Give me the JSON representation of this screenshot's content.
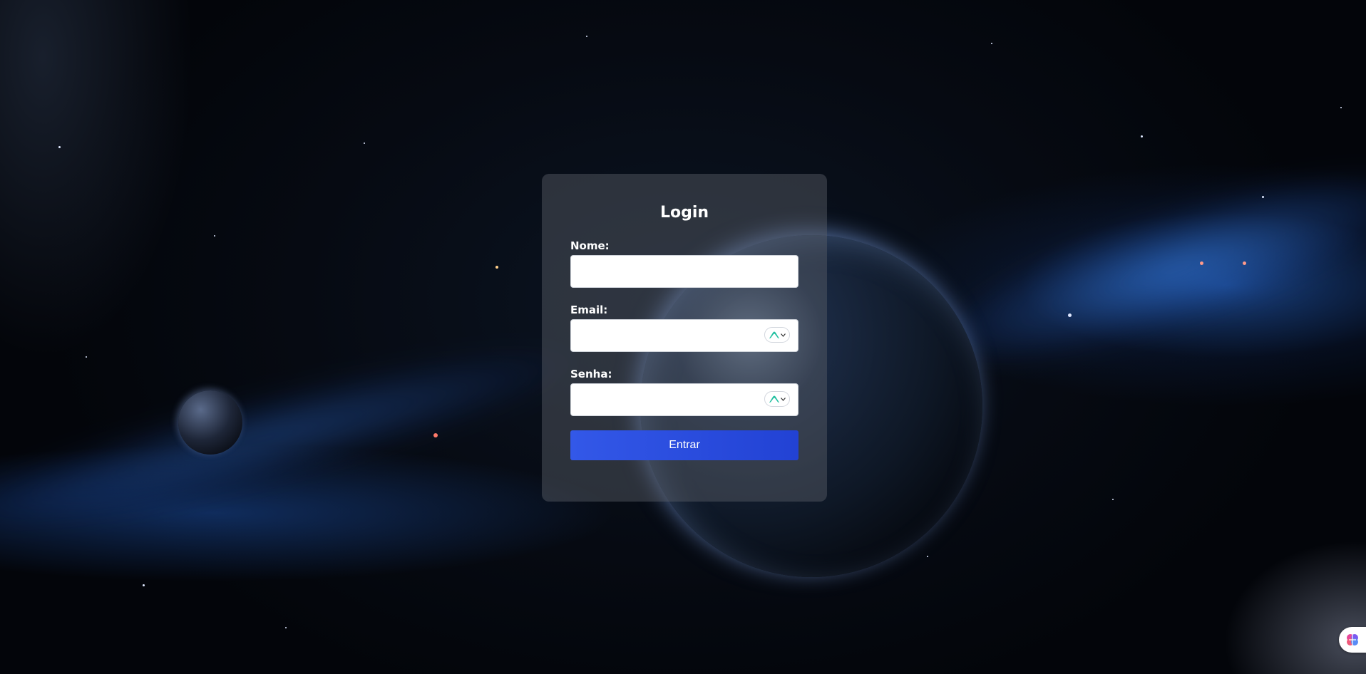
{
  "login": {
    "title": "Login",
    "fields": {
      "nome": {
        "label": "Nome:",
        "value": ""
      },
      "email": {
        "label": "Email:",
        "value": ""
      },
      "senha": {
        "label": "Senha:",
        "value": ""
      }
    },
    "submit_label": "Entrar"
  },
  "colors": {
    "button": "#2d4fe0",
    "card_bg": "rgba(90,95,105,0.45)",
    "autofill_accent": "#1fbf9f"
  },
  "icons": {
    "autofill": "password-manager-icon",
    "assistant": "brain-icon"
  }
}
